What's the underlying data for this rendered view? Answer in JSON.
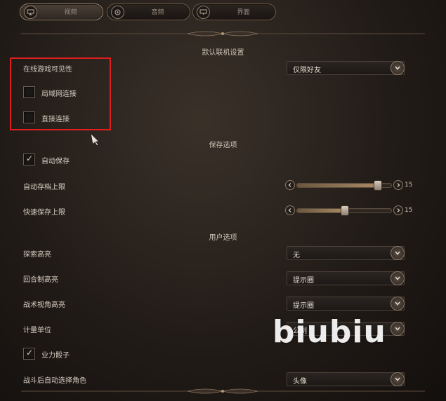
{
  "tabs": [
    {
      "label": "视频",
      "icon": "monitor-icon",
      "active": true
    },
    {
      "label": "音频",
      "icon": "speaker-icon",
      "active": false
    },
    {
      "label": "界面",
      "icon": "screen-icon",
      "active": false
    }
  ],
  "sections": {
    "online": {
      "title": "默认联机设置",
      "visibility_label": "在线游戏可见性",
      "visibility_value": "仅限好友",
      "lan_label": "局域网连接",
      "lan_checked": false,
      "direct_label": "直接连接",
      "direct_checked": false
    },
    "save": {
      "title": "保存选项",
      "autosave_label": "自动保存",
      "autosave_checked": true,
      "autosave_limit_label": "自动存档上限",
      "autosave_limit_value": "15",
      "autosave_limit_fraction": 0.85,
      "quicksave_limit_label": "快速保存上限",
      "quicksave_limit_value": "15",
      "quicksave_limit_fraction": 0.5
    },
    "user": {
      "title": "用户选项",
      "search_highlight_label": "探索高亮",
      "search_highlight_value": "无",
      "turn_highlight_label": "回合制高亮",
      "turn_highlight_value": "提示圈",
      "tactical_highlight_label": "战术视角高亮",
      "tactical_highlight_value": "提示圈",
      "units_label": "计量单位",
      "units_value": "公制",
      "karmic_dice_label": "业力骰子",
      "karmic_dice_checked": true,
      "auto_select_label": "战斗后自动选择角色",
      "auto_select_value": "头像"
    }
  },
  "watermark": "biubiu",
  "colors": {
    "annotation": "#e01e1e",
    "accent": "#a88a63"
  }
}
